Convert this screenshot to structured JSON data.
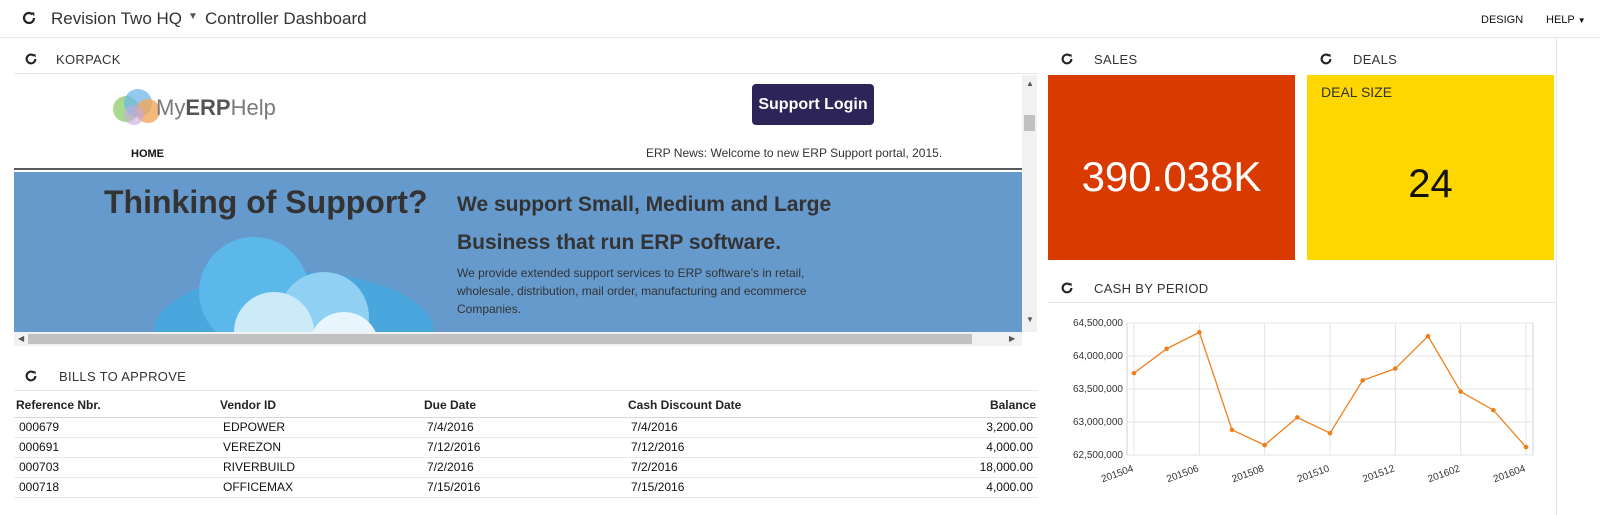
{
  "header": {
    "company": "Revision Two HQ",
    "dashboard_title": "Controller Dashboard",
    "design_label": "DESIGN",
    "help_label": "HELP"
  },
  "korpack": {
    "title": "KORPACK",
    "site": {
      "logo_text_pre": "My",
      "logo_text_bold": "ERP",
      "logo_text_post": "Help",
      "support_login": "Support Login",
      "nav_home": "HOME",
      "news": "ERP News: Welcome to new ERP Support portal, 2015.",
      "hero_title": "Thinking of Support?",
      "hero_heading": "We support Small, Medium and Large Business that run ERP software.",
      "hero_body": "We provide extended support services to ERP software's in retail, wholesale, distribution, mail order, manufacturing and ecommerce Companies."
    }
  },
  "bills": {
    "title": "BILLS TO APPROVE",
    "columns": [
      "Reference Nbr.",
      "Vendor ID",
      "Due Date",
      "Cash Discount Date",
      "Balance"
    ],
    "rows": [
      [
        "000679",
        "EDPOWER",
        "7/4/2016",
        "7/4/2016",
        "3,200.00"
      ],
      [
        "000691",
        "VEREZON",
        "7/12/2016",
        "7/12/2016",
        "4,000.00"
      ],
      [
        "000703",
        "RIVERBUILD",
        "7/2/2016",
        "7/2/2016",
        "18,000.00"
      ],
      [
        "000718",
        "OFFICEMAX",
        "7/15/2016",
        "7/15/2016",
        "4,000.00"
      ]
    ]
  },
  "sales": {
    "title": "SALES",
    "value": "390.038K",
    "color": "#d83a00"
  },
  "deals": {
    "title": "DEALS",
    "label": "DEAL SIZE",
    "value": "24",
    "color": "#ffd700"
  },
  "cash": {
    "title": "CASH BY PERIOD"
  },
  "chart_data": {
    "type": "line",
    "x": [
      "201504",
      "201505",
      "201506",
      "201507",
      "201508",
      "201509",
      "201510",
      "201511",
      "201512",
      "201601",
      "201602",
      "201603",
      "201604"
    ],
    "x_tick_labels": [
      "201504",
      "201506",
      "201508",
      "201510",
      "201512",
      "201602",
      "201604"
    ],
    "series": [
      {
        "values": [
          63740000,
          64110000,
          64360000,
          62880000,
          62650000,
          63070000,
          62830000,
          63630000,
          63810000,
          64300000,
          63460000,
          63180000,
          62620000
        ],
        "color": "#f07f1a"
      }
    ],
    "y_ticks": [
      "62,500,000",
      "63,000,000",
      "63,500,000",
      "64,000,000",
      "64,500,000"
    ],
    "ylim": [
      62500000,
      64500000
    ],
    "grid": true,
    "title": "",
    "xlabel": "",
    "ylabel": ""
  }
}
